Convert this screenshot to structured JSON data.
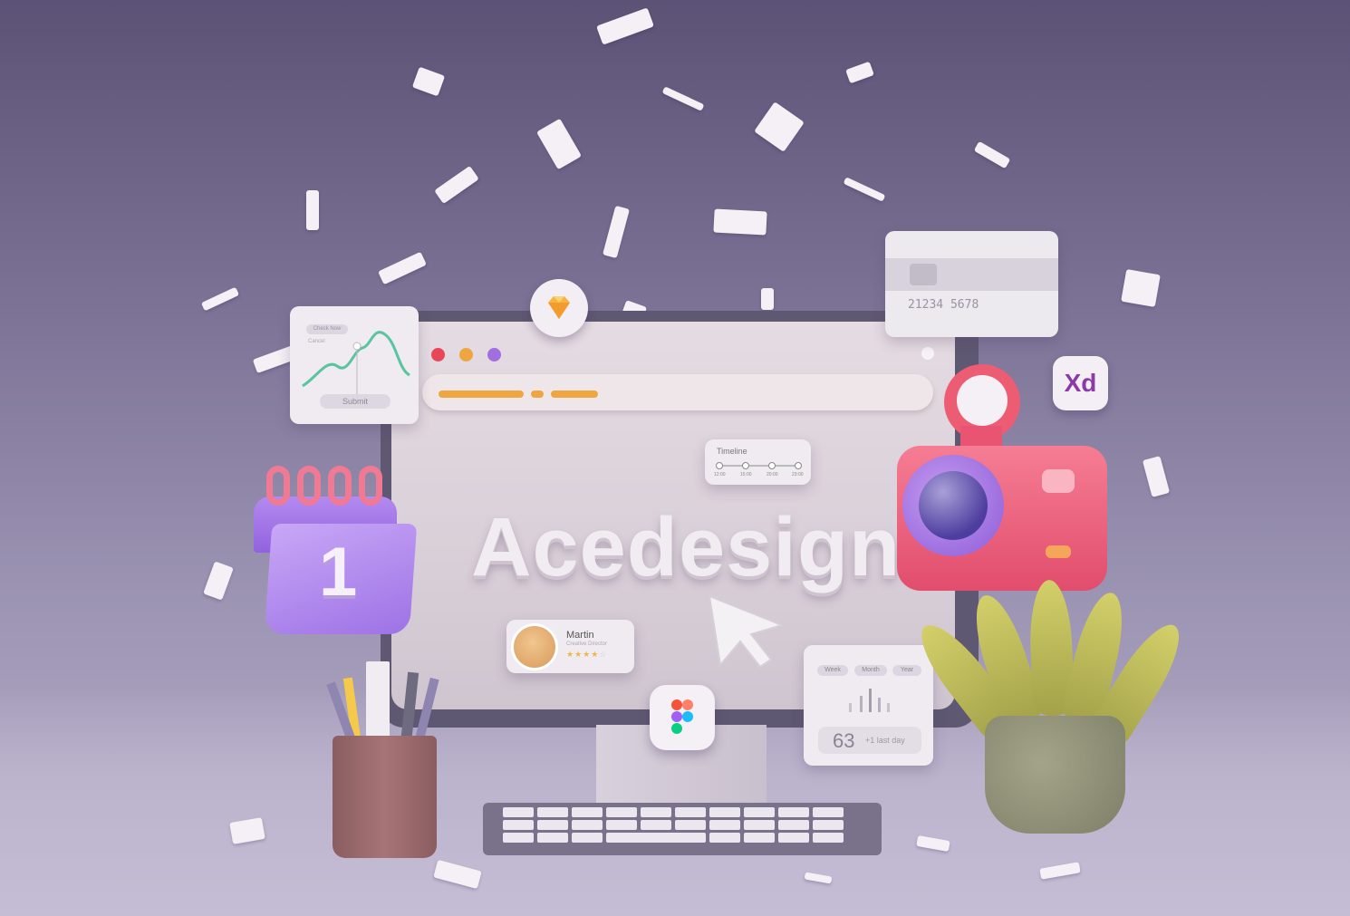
{
  "hero": {
    "title": "Acedesign"
  },
  "chart_card": {
    "tag1": "Check Now",
    "tag2": "Cancel",
    "button": "Submit"
  },
  "credit_card": {
    "number": "21234 5678"
  },
  "xd_badge": {
    "label": "Xd"
  },
  "timeline": {
    "title": "Timeline",
    "ticks": [
      "12:00",
      "15:00",
      "20:00",
      "23:00"
    ]
  },
  "profile": {
    "name": "Martin",
    "role": "Creative Director",
    "rating": 4
  },
  "stats": {
    "tabs": [
      "Week",
      "Month",
      "Year"
    ],
    "value": "63",
    "delta": "+1 last day"
  },
  "calendar": {
    "day": "1"
  },
  "colors": {
    "accent_orange": "#f0a640",
    "camera": "#e95a77",
    "calendar": "#a57be8",
    "background": "#7d7497"
  },
  "icons": [
    "sketch-diamond-icon",
    "figma-icon",
    "xd-icon",
    "cursor-arrow-icon",
    "camera-icon",
    "calendar-icon"
  ]
}
